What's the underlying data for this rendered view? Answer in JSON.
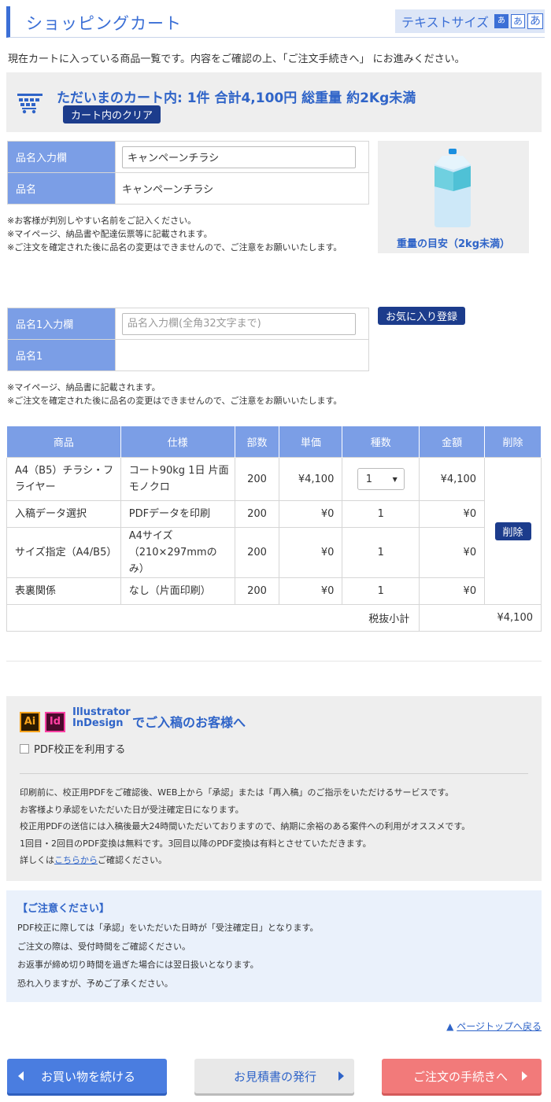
{
  "header": {
    "title": "ショッピングカート",
    "text_size_label": "テキストサイズ",
    "text_size_small": "あ",
    "text_size_medium": "あ",
    "text_size_large": "あ"
  },
  "intro": "現在カートに入っている商品一覧です。内容をご確認の上、「ご注文手続きへ」 にお進みください。",
  "summary": {
    "text": "ただいまのカート内:  1件   合計4,100円   総重量 約2Kg未満",
    "clear_label": "カート内のクリア"
  },
  "product_name": {
    "input_label": "品名入力欄",
    "input_value": "キャンペーンチラシ",
    "name_label": "品名",
    "name_value": "キャンペーンチラシ",
    "notes": [
      "※お客様が判別しやすい名前をご記入ください。",
      "※マイページ、納品書や配達伝票等に記載されます。",
      "※ご注文を確定された後に品名の変更はできませんので、ご注意をお願いいたします。"
    ]
  },
  "weight": {
    "label": "重量の目安（2kg未満）"
  },
  "product_name1": {
    "input_label": "品名1入力欄",
    "input_placeholder": "品名入力欄(全角32文字まで)",
    "name_label": "品名1",
    "favorite_label": "お気に入り登録",
    "notes": [
      "※マイページ、納品書に記載されます。",
      "※ご注文を確定された後に品名の変更はできませんので、ご注意をお願いいたします。"
    ]
  },
  "cart_table": {
    "headers": [
      "商品",
      "仕様",
      "部数",
      "単価",
      "種数",
      "金額",
      "削除"
    ],
    "rows": [
      {
        "product": "A4（B5）チラシ・フライヤー",
        "spec": "コート90kg 1日 片面モノクロ",
        "copies": "200",
        "unit_price": "¥4,100",
        "kinds": "1",
        "amount": "¥4,100"
      },
      {
        "product": "入稿データ選択",
        "spec": "PDFデータを印刷",
        "copies": "200",
        "unit_price": "¥0",
        "kinds": "1",
        "amount": "¥0"
      },
      {
        "product": "サイズ指定（A4/B5）",
        "spec": "A4サイズ（210×297mmのみ）",
        "copies": "200",
        "unit_price": "¥0",
        "kinds": "1",
        "amount": "¥0"
      },
      {
        "product": "表裏関係",
        "spec": "なし（片面印刷）",
        "copies": "200",
        "unit_price": "¥0",
        "kinds": "1",
        "amount": "¥0"
      }
    ],
    "delete_label": "削除",
    "subtotal_label": "税抜小計",
    "subtotal_value": "¥4,100"
  },
  "illustrator": {
    "ai_logo": "Ai",
    "id_logo": "Id",
    "brand_line1": "Illustrator",
    "brand_line2": "InDesign",
    "title": "でご入稿のお客様へ",
    "checkbox_label": "PDF校正を利用する",
    "lines": [
      "印刷前に、校正用PDFをご確認後、WEB上から「承認」または「再入稿」のご指示をいただけるサービスです。",
      "お客様より承認をいただいた日が受注確定日になります。",
      "校正用PDFの送信には入稿後最大24時間いただいておりますので、納期に余裕のある案件への利用がオススメです。",
      "1回目・2回目のPDF変換は無料です。3回目以降のPDF変換は有料とさせていただきます。"
    ],
    "details_prefix": "詳しくは",
    "details_link": "こちらから",
    "details_suffix": "ご確認ください。"
  },
  "notice": {
    "title": "【ご注意ください】",
    "lines": [
      "PDF校正に際しては「承認」をいただいた日時が「受注確定日」となります。",
      "ご注文の際は、受付時間をご確認ください。",
      "お返事が締め切り時間を過ぎた場合には翌日扱いとなります。",
      "恐れ入りますが、予めご了承ください。"
    ]
  },
  "pagetop": {
    "arrow": "▲",
    "label": "ページトップへ戻る"
  },
  "buttons": {
    "continue": "お買い物を続ける",
    "quote": "お見積書の発行",
    "order": "ご注文の手続きへ"
  }
}
